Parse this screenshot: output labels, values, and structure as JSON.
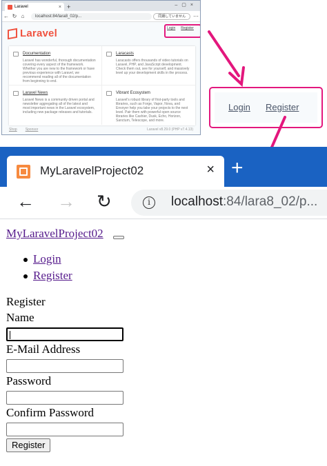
{
  "mini": {
    "tab_title": "Laravel",
    "url": "localhost:84/lara8_02/p...",
    "status": "同期していません",
    "logo_text": "Laravel",
    "nav": {
      "login": "Login",
      "register": "Register"
    },
    "cards": [
      {
        "title": "Documentation",
        "text": "Laravel has wonderful, thorough documentation covering every aspect of the framework. Whether you are new to the framework or have previous experience with Laravel, we recommend reading all of the documentation from beginning to end."
      },
      {
        "title": "Laracasts",
        "text": "Laracasts offers thousands of video tutorials on Laravel, PHP, and JavaScript development. Check them out, see for yourself, and massively level up your development skills in the process."
      },
      {
        "title": "Laravel News",
        "text": "Laravel News is a community driven portal and newsletter aggregating all of the latest and most important news in the Laravel ecosystem, including new package releases and tutorials."
      },
      {
        "title": "Vibrant Ecosystem",
        "text": "Laravel's robust library of first-party tools and libraries, such as Forge, Vapor, Nova, and Envoyer help you take your projects to the next level. Pair them with powerful open source libraries like Cashier, Dusk, Echo, Horizon, Sanctum, Telescope, and more."
      }
    ],
    "footer": {
      "shop": "Shop",
      "sponsor": "Sponsor",
      "version": "Laravel v8.29.0 (PHP v7.4.13)"
    }
  },
  "zoom": {
    "login": "Login",
    "register": "Register"
  },
  "browser": {
    "tab_title": "MyLaravelProject02",
    "tab_close": "×",
    "new_tab": "+",
    "back": "←",
    "forward": "→",
    "reload": "↻",
    "info": "i",
    "url_host": "localhost",
    "url_rest": ":84/lara8_02/p..."
  },
  "page": {
    "brand": "MyLaravelProject02",
    "nav": [
      "Login",
      "Register"
    ],
    "heading": "Register",
    "fields": [
      {
        "label": "Name",
        "value": ""
      },
      {
        "label": "E-Mail Address",
        "value": ""
      },
      {
        "label": "Password",
        "value": ""
      },
      {
        "label": "Confirm Password",
        "value": ""
      }
    ],
    "submit": "Register"
  },
  "colors": {
    "accent_arrow": "#e3177d",
    "tab_bar": "#1a62c2",
    "visited_link": "#551a8b",
    "laravel_red": "#f05340"
  }
}
